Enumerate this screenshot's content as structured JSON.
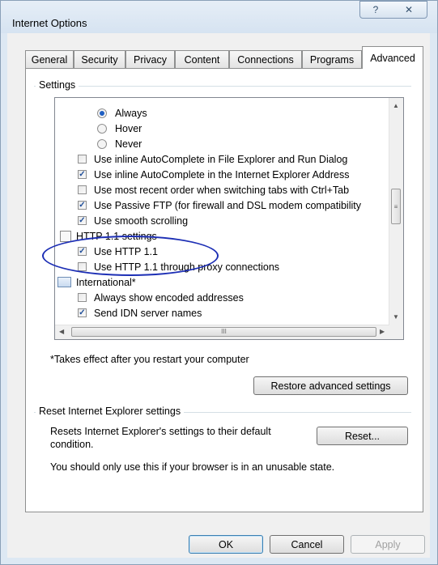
{
  "window": {
    "title": "Internet Options",
    "help_glyph": "?",
    "close_glyph": "✕"
  },
  "tabs": [
    "General",
    "Security",
    "Privacy",
    "Content",
    "Connections",
    "Programs",
    "Advanced"
  ],
  "active_tab": "Advanced",
  "settings": {
    "group_label": "Settings",
    "items": [
      {
        "label": "Always",
        "control": "radio",
        "checked": true
      },
      {
        "label": "Hover",
        "control": "radio",
        "checked": false
      },
      {
        "label": "Never",
        "control": "radio",
        "checked": false
      },
      {
        "label": "Use inline AutoComplete in File Explorer and Run Dialog",
        "control": "checkbox",
        "checked": false
      },
      {
        "label": "Use inline AutoComplete in the Internet Explorer Address",
        "control": "checkbox",
        "checked": true
      },
      {
        "label": "Use most recent order when switching tabs with Ctrl+Tab",
        "control": "checkbox",
        "checked": false
      },
      {
        "label": "Use Passive FTP (for firewall and DSL modem compatibility",
        "control": "checkbox",
        "checked": true
      },
      {
        "label": "Use smooth scrolling",
        "control": "checkbox",
        "checked": true
      },
      {
        "label": "HTTP 1.1 settings",
        "control": "category",
        "icon": "folder-icon"
      },
      {
        "label": "Use HTTP 1.1",
        "control": "checkbox",
        "checked": true
      },
      {
        "label": "Use HTTP 1.1 through proxy connections",
        "control": "checkbox",
        "checked": false
      },
      {
        "label": "International*",
        "control": "category",
        "icon": "globe-icon"
      },
      {
        "label": "Always show encoded addresses",
        "control": "checkbox",
        "checked": false
      },
      {
        "label": "Send IDN server names",
        "control": "checkbox",
        "checked": true
      }
    ],
    "note": "*Takes effect after you restart your computer",
    "restore_button": "Restore advanced settings"
  },
  "reset": {
    "group_label": "Reset Internet Explorer settings",
    "description": "Resets Internet Explorer's settings to their default condition.",
    "reset_button": "Reset...",
    "warning": "You should only use this if your browser is in an unusable state."
  },
  "buttons": {
    "ok": "OK",
    "cancel": "Cancel",
    "apply": "Apply"
  },
  "colors": {
    "annotation_ellipse": "#1d2fb5",
    "check_mark": "#1f4e9a"
  }
}
